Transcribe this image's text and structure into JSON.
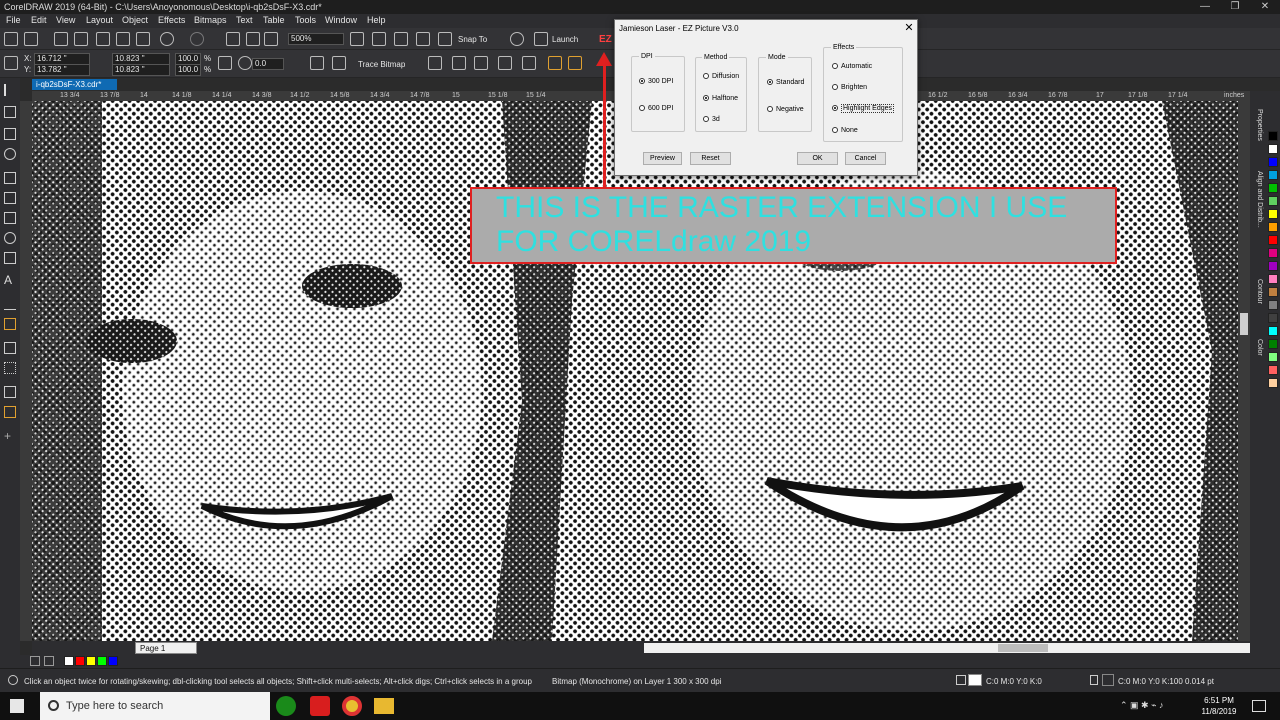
{
  "window": {
    "title": "CorelDRAW 2019 (64-Bit) - C:\\Users\\Anoyonomous\\Desktop\\i-qb2sDsF-X3.cdr*",
    "controls": [
      "—",
      "❐",
      "✕"
    ]
  },
  "menu": [
    "File",
    "Edit",
    "View",
    "Layout",
    "Object",
    "Effects",
    "Bitmaps",
    "Text",
    "Table",
    "Tools",
    "Window",
    "Help"
  ],
  "toolbar1": {
    "zoom_value": "500%",
    "snap_to_label": "Snap To",
    "launch_label": "Launch",
    "ez_label": "EZ"
  },
  "toolbar2": {
    "x_value": "16.712 \"",
    "y_value": "13.782 \"",
    "width_value": "10.823 \"",
    "height_value": "10.823 \"",
    "scale_x": "100.0",
    "scale_y": "100.0",
    "pct": "%",
    "rotation_value": "0.0",
    "trace_bitmap_label": "Trace Bitmap"
  },
  "document_tab": "i-qb2sDsF-X3.cdr*",
  "ruler": {
    "ticks": [
      "13 3/4",
      "13 7/8",
      "14",
      "14 1/8",
      "14 1/4",
      "14 3/8",
      "14 1/2",
      "14 5/8",
      "14 3/4",
      "14 7/8",
      "15",
      "15 1/8",
      "15 1/4",
      "16 1/2",
      "16 5/8",
      "16 3/4",
      "16 7/8",
      "17",
      "17 1/8",
      "17 1/4"
    ],
    "units": "inches"
  },
  "dialog": {
    "title": "Jamieson Laser - EZ Picture V3.0",
    "close": "✕",
    "dpi": {
      "title": "DPI",
      "options": [
        "300 DPI",
        "600 DPI"
      ],
      "selected": "300 DPI"
    },
    "method": {
      "title": "Method",
      "options": [
        "Diffusion",
        "Halftone",
        "3d"
      ],
      "selected": "Halftone"
    },
    "mode": {
      "title": "Mode",
      "options": [
        "Standard",
        "Negative"
      ],
      "selected": "Standard"
    },
    "effects": {
      "title": "Effects",
      "options": [
        "Automatic",
        "Brighten",
        "Highlight Edges",
        "None"
      ],
      "selected": "Highlight Edges"
    },
    "buttons": {
      "preview": "Preview",
      "reset": "Reset",
      "ok": "OK",
      "cancel": "Cancel"
    }
  },
  "annotation": {
    "text": "THIS IS THE RASTER EXTENSION I USE FOR CORELdraw 2019",
    "text_color": "#2fe0e0",
    "border_color": "#e02020"
  },
  "dockers": [
    "Properties",
    "Align and Distrib...",
    "Contour",
    "Color"
  ],
  "palette_colors": [
    "#000000",
    "#ffffff",
    "#0000ff",
    "#00a0e0",
    "#00c000",
    "#60d060",
    "#ffff00",
    "#ffa000",
    "#ff0000",
    "#e00080",
    "#a000c0",
    "#ff80c0",
    "#c08040",
    "#808080",
    "#404040",
    "#00ffff",
    "#008000",
    "#80ff80",
    "#ff6060",
    "#ffd0a0"
  ],
  "page_tab": "Page 1",
  "doc_palette": [
    "#ffffff",
    "#ff0000",
    "#ffff00",
    "#00ff00",
    "#0000ff"
  ],
  "status": {
    "hint": "Click an object twice for rotating/skewing; dbl-clicking tool selects all objects; Shift+click multi-selects; Alt+click digs; Ctrl+click selects in a group",
    "selection": "Bitmap (Monochrome) on Layer 1 300 x 300 dpi",
    "fill": "C:0 M:0 Y:0 K:0",
    "outline": "C:0 M:0 Y:0 K:100  0.014 pt"
  },
  "taskbar": {
    "search_placeholder": "Type here to search",
    "time": "6:51 PM",
    "date": "11/8/2019"
  }
}
